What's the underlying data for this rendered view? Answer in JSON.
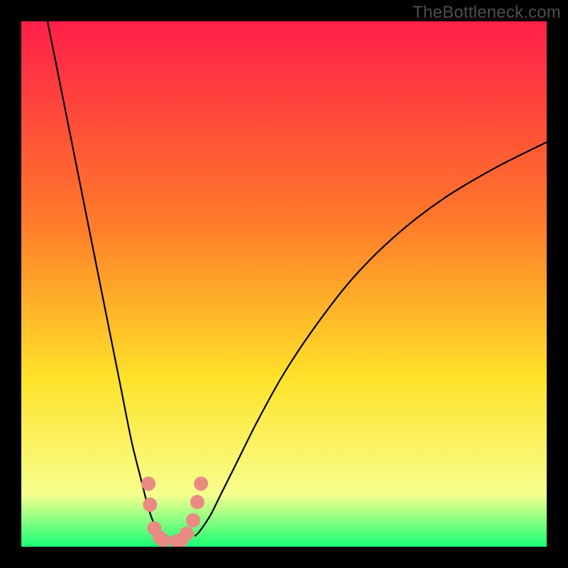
{
  "watermark": "TheBottleneck.com",
  "chart_data": {
    "type": "line",
    "title": "",
    "xlabel": "",
    "ylabel": "",
    "xlim": [
      0,
      100
    ],
    "ylim": [
      0,
      100
    ],
    "grid": false,
    "background_gradient": {
      "top": "#ff1f4a",
      "mid1": "#ff7a2a",
      "mid2": "#ffe22a",
      "low": "#f7ff8e",
      "bottom": "#19ff75"
    },
    "series": [
      {
        "name": "curve-left",
        "color": "#000000",
        "x": [
          5,
          7,
          9,
          11,
          13,
          15,
          17,
          19,
          21,
          23,
          24,
          25,
          26,
          26.5
        ],
        "values": [
          100,
          90,
          80,
          70,
          60,
          50,
          40,
          30,
          20,
          12,
          8,
          5,
          3,
          2
        ]
      },
      {
        "name": "curve-right",
        "color": "#000000",
        "x": [
          33,
          34,
          36,
          38,
          41,
          45,
          50,
          56,
          63,
          71,
          80,
          90,
          100
        ],
        "values": [
          2,
          3,
          6,
          10,
          16,
          24,
          33,
          42,
          51,
          59,
          66,
          72,
          77
        ]
      },
      {
        "name": "markers-left",
        "type": "scatter",
        "color": "#e98b83",
        "x": [
          24.2,
          24.5,
          25.3,
          26.3,
          27.0
        ],
        "values": [
          12.0,
          8.0,
          3.5,
          1.8,
          1.2
        ]
      },
      {
        "name": "markers-right",
        "type": "scatter",
        "color": "#e98b83",
        "x": [
          29.5,
          30.5,
          31.5,
          32.7,
          33.5,
          34.2
        ],
        "values": [
          1.0,
          1.3,
          2.5,
          5.0,
          8.5,
          12.0
        ]
      }
    ]
  }
}
